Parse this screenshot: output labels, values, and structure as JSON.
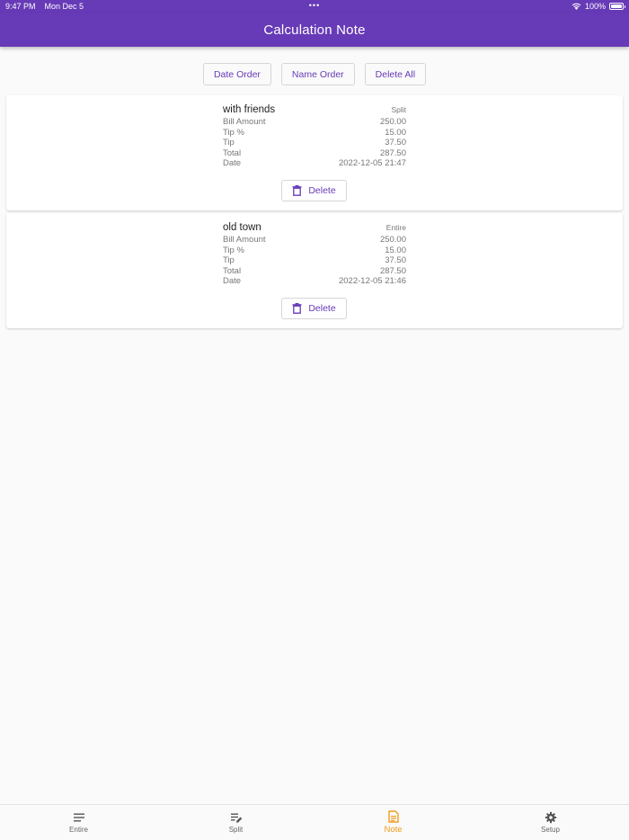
{
  "status": {
    "time": "9:47 PM",
    "date": "Mon Dec 5",
    "dots": "•••",
    "battery": "100%"
  },
  "app": {
    "title": "Calculation Note"
  },
  "toolbar": {
    "date_order": "Date Order",
    "name_order": "Name Order",
    "delete_all": "Delete All"
  },
  "labels": {
    "bill": "Bill Amount",
    "tip_pct": "Tip %",
    "tip": "Tip",
    "total": "Total",
    "date": "Date",
    "delete": "Delete"
  },
  "notes": [
    {
      "name": "with friends",
      "type": "Split",
      "bill": "250.00",
      "tip_pct": "15.00",
      "tip": "37.50",
      "total": "287.50",
      "date": "2022-12-05 21:47"
    },
    {
      "name": "old town",
      "type": "Entire",
      "bill": "250.00",
      "tip_pct": "15.00",
      "tip": "37.50",
      "total": "287.50",
      "date": "2022-12-05 21:46"
    }
  ],
  "nav": [
    {
      "label": "Entire",
      "icon": "lines-icon"
    },
    {
      "label": "Split",
      "icon": "edit-list-icon"
    },
    {
      "label": "Note",
      "icon": "note-icon"
    },
    {
      "label": "Setup",
      "icon": "gear-icon"
    }
  ],
  "colors": {
    "primary": "#673ab7",
    "active_nav": "#ef9d1c"
  }
}
